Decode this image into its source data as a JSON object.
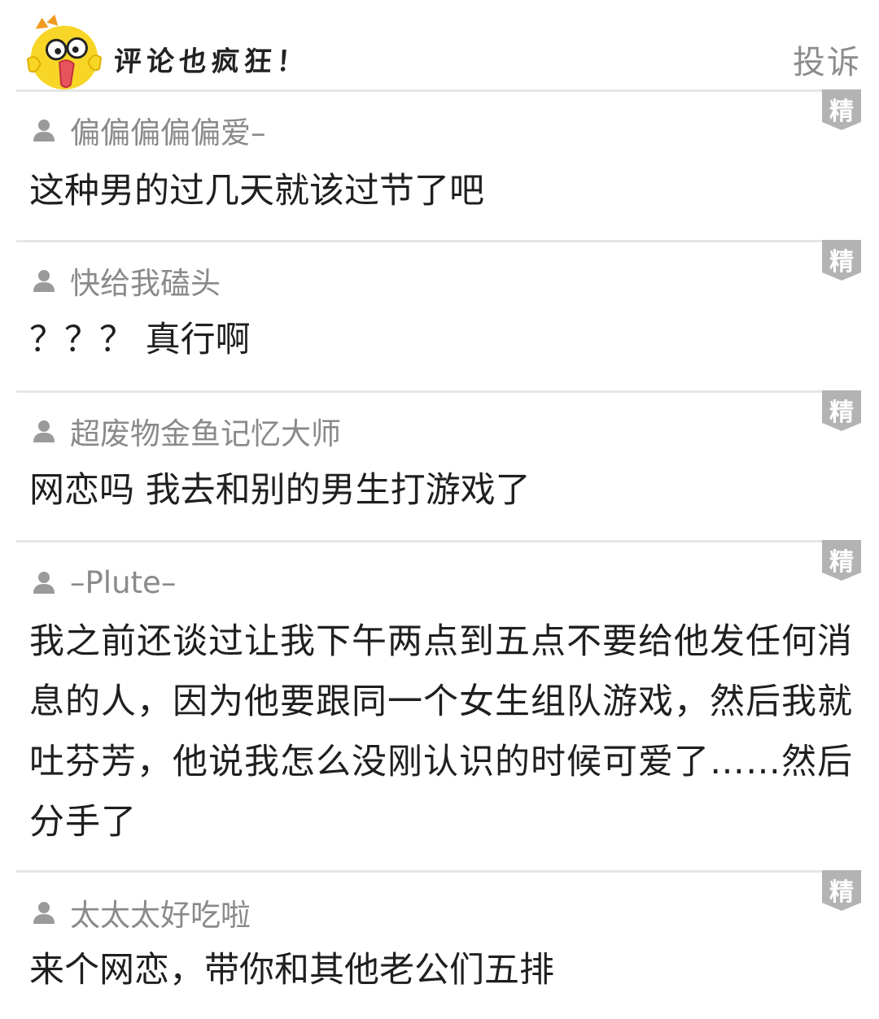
{
  "header": {
    "title": "评论也疯狂！",
    "report_label": "投诉",
    "mascot_icon": "yellow-chick-icon"
  },
  "badge_label": "精",
  "colors": {
    "badge": "#b3b3b3",
    "username": "#8a8a8a",
    "text": "#1f1f1f",
    "divider": "#e6e6e6"
  },
  "comments": [
    {
      "username": "偏偏偏偏偏爱–",
      "text": "这种男的过几天就该过节了吧"
    },
    {
      "username": "快给我磕头",
      "text": "？？？ 真行啊"
    },
    {
      "username": "超废物金鱼记忆大师",
      "text": "网恋吗 我去和别的男生打游戏了"
    },
    {
      "username": "–Plute–",
      "text": "我之前还谈过让我下午两点到五点不要给他发任何消息的人，因为他要跟同一个女生组队游戏，然后我就吐芬芳，他说我怎么没刚认识的时候可爱了……然后分手了"
    },
    {
      "username": "太太太好吃啦",
      "text": "来个网恋，带你和其他老公们五排"
    }
  ]
}
